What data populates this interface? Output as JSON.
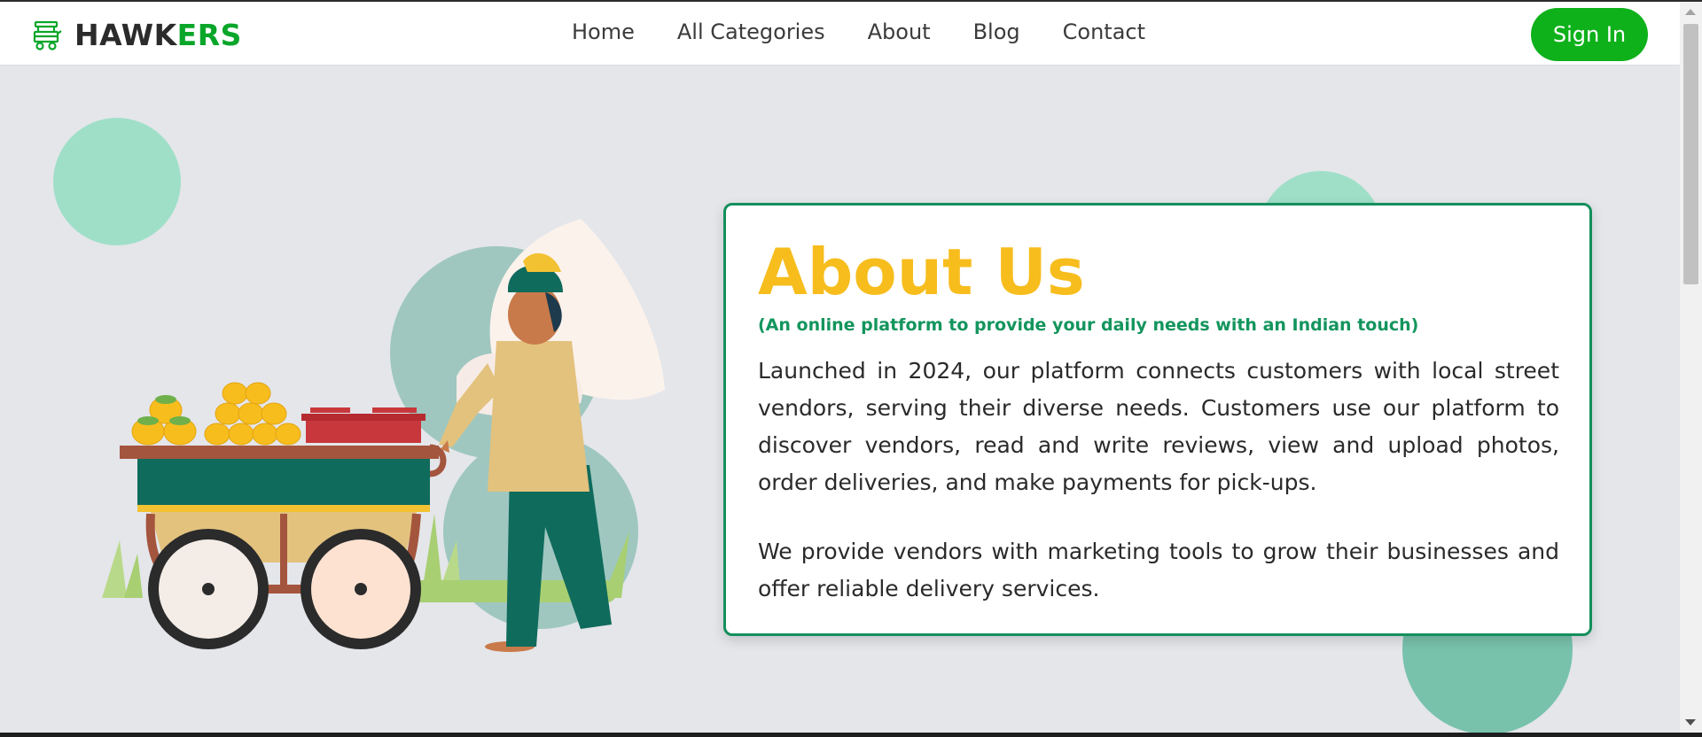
{
  "brand": {
    "part1": "HAWK",
    "part2": "ERS",
    "icon": "food-cart-icon"
  },
  "nav": {
    "items": [
      {
        "label": "Home"
      },
      {
        "label": "All Categories"
      },
      {
        "label": "About"
      },
      {
        "label": "Blog"
      },
      {
        "label": "Contact"
      }
    ]
  },
  "header": {
    "signin_label": "Sign In"
  },
  "about": {
    "title": "About Us",
    "subtitle": "(An online platform to provide your daily needs with an Indian touch)",
    "paragraph1": "Launched in 2024, our platform connects customers with local street vendors, serving their diverse needs. Customers use our platform to discover vendors, read and write reviews, view and upload photos, order deliveries, and make payments for pick-ups.",
    "paragraph2": "We provide vendors with marketing tools to grow their businesses and offer reliable delivery services."
  },
  "colors": {
    "brand_green": "#0aa62a",
    "signin_green": "#0fb11b",
    "title_yellow": "#f7bd1d",
    "card_border": "#148f5d",
    "subtitle_green": "#13955d",
    "circle_mint": "#9fdfc8",
    "circle_teal": "#78c2ab",
    "page_bg": "#e4e6ea"
  },
  "illustration": {
    "subject": "street-vendor-with-fruit-cart-illustration"
  }
}
